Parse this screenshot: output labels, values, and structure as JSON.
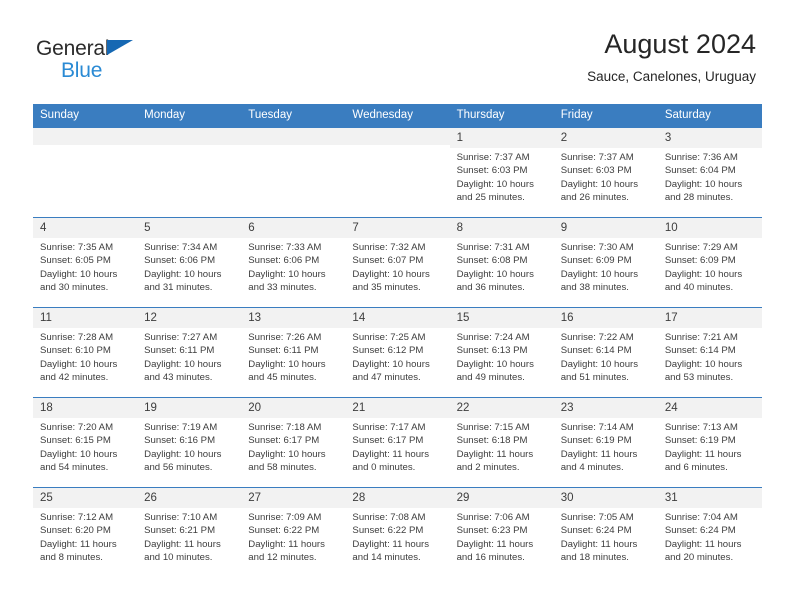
{
  "brand": {
    "line1": "General",
    "line2": "Blue",
    "triangle_color": "#1668b3",
    "blue_text_color": "#2a8ad4"
  },
  "header": {
    "title": "August 2024",
    "subtitle": "Sauce, Canelones, Uruguay"
  },
  "theme": {
    "header_blue": "#3a7dc0",
    "daynum_band": "#f2f2f2",
    "text": "#3d3d3d"
  },
  "weekday_headers": [
    "Sunday",
    "Monday",
    "Tuesday",
    "Wednesday",
    "Thursday",
    "Friday",
    "Saturday"
  ],
  "labels": {
    "sunrise_prefix": "Sunrise:",
    "sunset_prefix": "Sunset:",
    "daylight_prefix": "Daylight:"
  },
  "weeks": [
    [
      {
        "day": "",
        "blank": true
      },
      {
        "day": "",
        "blank": true
      },
      {
        "day": "",
        "blank": true
      },
      {
        "day": "",
        "blank": true
      },
      {
        "day": "1",
        "sunrise": "Sunrise: 7:37 AM",
        "sunset": "Sunset: 6:03 PM",
        "daylight1": "Daylight: 10 hours",
        "daylight2": "and 25 minutes."
      },
      {
        "day": "2",
        "sunrise": "Sunrise: 7:37 AM",
        "sunset": "Sunset: 6:03 PM",
        "daylight1": "Daylight: 10 hours",
        "daylight2": "and 26 minutes."
      },
      {
        "day": "3",
        "sunrise": "Sunrise: 7:36 AM",
        "sunset": "Sunset: 6:04 PM",
        "daylight1": "Daylight: 10 hours",
        "daylight2": "and 28 minutes."
      }
    ],
    [
      {
        "day": "4",
        "sunrise": "Sunrise: 7:35 AM",
        "sunset": "Sunset: 6:05 PM",
        "daylight1": "Daylight: 10 hours",
        "daylight2": "and 30 minutes."
      },
      {
        "day": "5",
        "sunrise": "Sunrise: 7:34 AM",
        "sunset": "Sunset: 6:06 PM",
        "daylight1": "Daylight: 10 hours",
        "daylight2": "and 31 minutes."
      },
      {
        "day": "6",
        "sunrise": "Sunrise: 7:33 AM",
        "sunset": "Sunset: 6:06 PM",
        "daylight1": "Daylight: 10 hours",
        "daylight2": "and 33 minutes."
      },
      {
        "day": "7",
        "sunrise": "Sunrise: 7:32 AM",
        "sunset": "Sunset: 6:07 PM",
        "daylight1": "Daylight: 10 hours",
        "daylight2": "and 35 minutes."
      },
      {
        "day": "8",
        "sunrise": "Sunrise: 7:31 AM",
        "sunset": "Sunset: 6:08 PM",
        "daylight1": "Daylight: 10 hours",
        "daylight2": "and 36 minutes."
      },
      {
        "day": "9",
        "sunrise": "Sunrise: 7:30 AM",
        "sunset": "Sunset: 6:09 PM",
        "daylight1": "Daylight: 10 hours",
        "daylight2": "and 38 minutes."
      },
      {
        "day": "10",
        "sunrise": "Sunrise: 7:29 AM",
        "sunset": "Sunset: 6:09 PM",
        "daylight1": "Daylight: 10 hours",
        "daylight2": "and 40 minutes."
      }
    ],
    [
      {
        "day": "11",
        "sunrise": "Sunrise: 7:28 AM",
        "sunset": "Sunset: 6:10 PM",
        "daylight1": "Daylight: 10 hours",
        "daylight2": "and 42 minutes."
      },
      {
        "day": "12",
        "sunrise": "Sunrise: 7:27 AM",
        "sunset": "Sunset: 6:11 PM",
        "daylight1": "Daylight: 10 hours",
        "daylight2": "and 43 minutes."
      },
      {
        "day": "13",
        "sunrise": "Sunrise: 7:26 AM",
        "sunset": "Sunset: 6:11 PM",
        "daylight1": "Daylight: 10 hours",
        "daylight2": "and 45 minutes."
      },
      {
        "day": "14",
        "sunrise": "Sunrise: 7:25 AM",
        "sunset": "Sunset: 6:12 PM",
        "daylight1": "Daylight: 10 hours",
        "daylight2": "and 47 minutes."
      },
      {
        "day": "15",
        "sunrise": "Sunrise: 7:24 AM",
        "sunset": "Sunset: 6:13 PM",
        "daylight1": "Daylight: 10 hours",
        "daylight2": "and 49 minutes."
      },
      {
        "day": "16",
        "sunrise": "Sunrise: 7:22 AM",
        "sunset": "Sunset: 6:14 PM",
        "daylight1": "Daylight: 10 hours",
        "daylight2": "and 51 minutes."
      },
      {
        "day": "17",
        "sunrise": "Sunrise: 7:21 AM",
        "sunset": "Sunset: 6:14 PM",
        "daylight1": "Daylight: 10 hours",
        "daylight2": "and 53 minutes."
      }
    ],
    [
      {
        "day": "18",
        "sunrise": "Sunrise: 7:20 AM",
        "sunset": "Sunset: 6:15 PM",
        "daylight1": "Daylight: 10 hours",
        "daylight2": "and 54 minutes."
      },
      {
        "day": "19",
        "sunrise": "Sunrise: 7:19 AM",
        "sunset": "Sunset: 6:16 PM",
        "daylight1": "Daylight: 10 hours",
        "daylight2": "and 56 minutes."
      },
      {
        "day": "20",
        "sunrise": "Sunrise: 7:18 AM",
        "sunset": "Sunset: 6:17 PM",
        "daylight1": "Daylight: 10 hours",
        "daylight2": "and 58 minutes."
      },
      {
        "day": "21",
        "sunrise": "Sunrise: 7:17 AM",
        "sunset": "Sunset: 6:17 PM",
        "daylight1": "Daylight: 11 hours",
        "daylight2": "and 0 minutes."
      },
      {
        "day": "22",
        "sunrise": "Sunrise: 7:15 AM",
        "sunset": "Sunset: 6:18 PM",
        "daylight1": "Daylight: 11 hours",
        "daylight2": "and 2 minutes."
      },
      {
        "day": "23",
        "sunrise": "Sunrise: 7:14 AM",
        "sunset": "Sunset: 6:19 PM",
        "daylight1": "Daylight: 11 hours",
        "daylight2": "and 4 minutes."
      },
      {
        "day": "24",
        "sunrise": "Sunrise: 7:13 AM",
        "sunset": "Sunset: 6:19 PM",
        "daylight1": "Daylight: 11 hours",
        "daylight2": "and 6 minutes."
      }
    ],
    [
      {
        "day": "25",
        "sunrise": "Sunrise: 7:12 AM",
        "sunset": "Sunset: 6:20 PM",
        "daylight1": "Daylight: 11 hours",
        "daylight2": "and 8 minutes."
      },
      {
        "day": "26",
        "sunrise": "Sunrise: 7:10 AM",
        "sunset": "Sunset: 6:21 PM",
        "daylight1": "Daylight: 11 hours",
        "daylight2": "and 10 minutes."
      },
      {
        "day": "27",
        "sunrise": "Sunrise: 7:09 AM",
        "sunset": "Sunset: 6:22 PM",
        "daylight1": "Daylight: 11 hours",
        "daylight2": "and 12 minutes."
      },
      {
        "day": "28",
        "sunrise": "Sunrise: 7:08 AM",
        "sunset": "Sunset: 6:22 PM",
        "daylight1": "Daylight: 11 hours",
        "daylight2": "and 14 minutes."
      },
      {
        "day": "29",
        "sunrise": "Sunrise: 7:06 AM",
        "sunset": "Sunset: 6:23 PM",
        "daylight1": "Daylight: 11 hours",
        "daylight2": "and 16 minutes."
      },
      {
        "day": "30",
        "sunrise": "Sunrise: 7:05 AM",
        "sunset": "Sunset: 6:24 PM",
        "daylight1": "Daylight: 11 hours",
        "daylight2": "and 18 minutes."
      },
      {
        "day": "31",
        "sunrise": "Sunrise: 7:04 AM",
        "sunset": "Sunset: 6:24 PM",
        "daylight1": "Daylight: 11 hours",
        "daylight2": "and 20 minutes."
      }
    ]
  ]
}
